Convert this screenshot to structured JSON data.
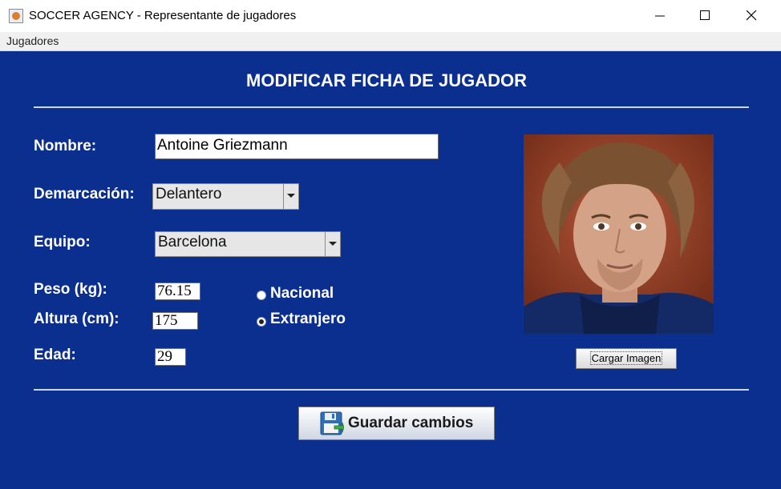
{
  "window": {
    "title": "SOCCER AGENCY - Representante de jugadores",
    "icon": "java-coffee-icon"
  },
  "menu": {
    "items": [
      {
        "label": "Jugadores"
      }
    ]
  },
  "form": {
    "heading": "MODIFICAR FICHA DE JUGADOR",
    "nombre": {
      "label": "Nombre:",
      "value": "Antoine Griezmann"
    },
    "demarcacion": {
      "label": "Demarcación:",
      "selected": "Delantero"
    },
    "equipo": {
      "label": "Equipo:",
      "selected": "Barcelona"
    },
    "peso": {
      "label": "Peso (kg):",
      "value": "76.15"
    },
    "altura": {
      "label": "Altura (cm):",
      "value": "175"
    },
    "edad": {
      "label": "Edad:",
      "value": "29"
    },
    "nacionalidad": {
      "options": [
        {
          "label": "Nacional",
          "selected": false
        },
        {
          "label": "Extranjero",
          "selected": true
        }
      ]
    },
    "cargar_imagen_label": "Cargar Imagen",
    "guardar_label": "Guardar cambios",
    "guardar_icon": "floppy-disk-icon",
    "photo_icon": "player-photo"
  },
  "colors": {
    "background": "#0b2f8f",
    "text": "#ffffff"
  }
}
